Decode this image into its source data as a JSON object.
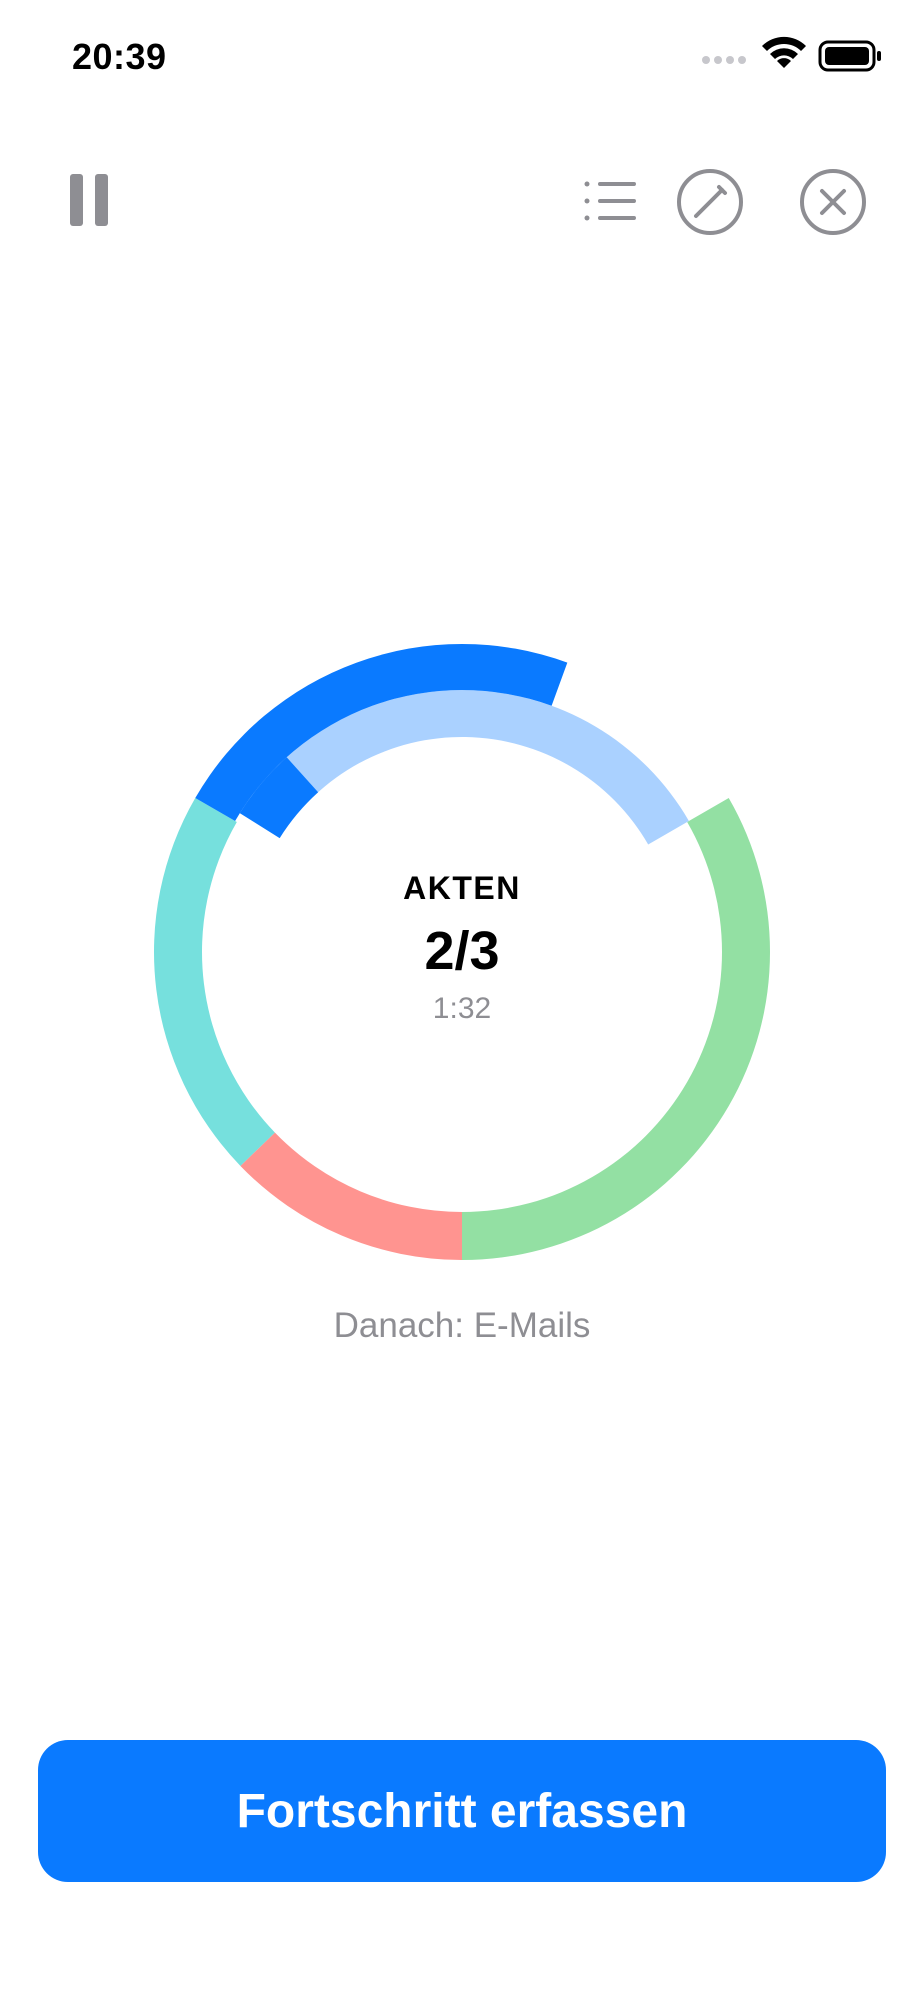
{
  "status_bar": {
    "time": "20:39",
    "signal_icon": "signal-dots-icon",
    "wifi_icon": "wifi-icon",
    "battery_icon": "battery-full-icon"
  },
  "toolbar": {
    "pause_icon": "pause-icon",
    "list_icon": "list-icon",
    "edit_icon": "pencil-circle-icon",
    "close_icon": "x-circle-icon",
    "icon_color": "#8e8e93"
  },
  "timer": {
    "task_name": "AKTEN",
    "progress": "2/3",
    "remaining": "1:32",
    "next_label": "Danach: E-Mails",
    "colors": {
      "active_dark": "#0a7aff",
      "active_light": "#aad1ff",
      "green": "#93e0a3",
      "red": "#ff9490",
      "teal": "#76e0dd"
    }
  },
  "actions": {
    "primary_label": "Fortschritt erfassen",
    "primary_color": "#0a7aff"
  }
}
